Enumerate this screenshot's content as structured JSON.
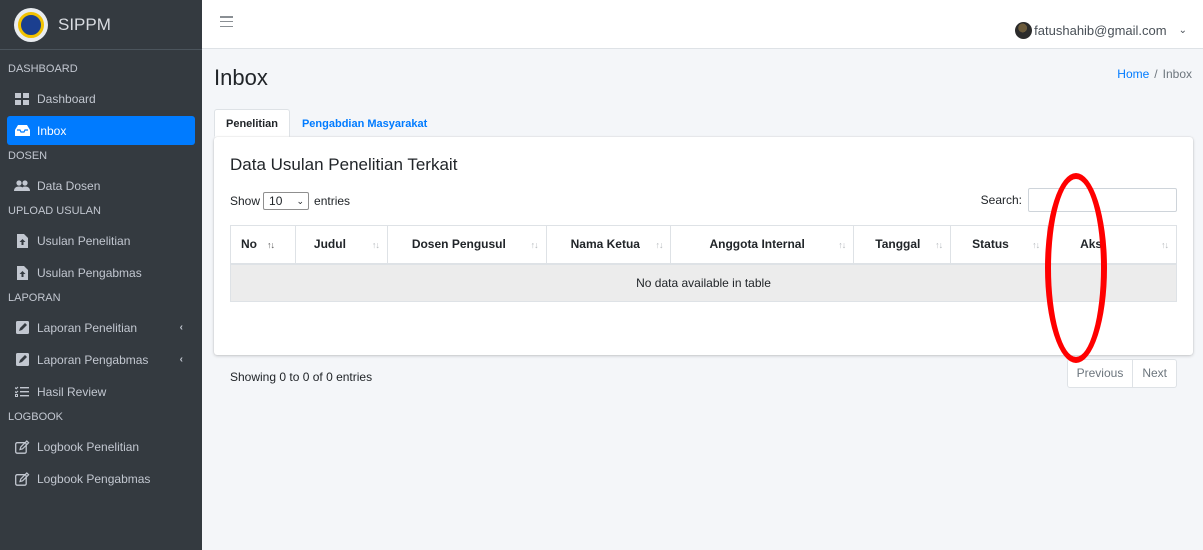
{
  "brand": {
    "name": "SIPPM"
  },
  "sidebar": {
    "sections": [
      {
        "header": "DASHBOARD",
        "items": [
          {
            "label": "Dashboard",
            "icon": "th-large-icon",
            "active": false
          },
          {
            "label": "Inbox",
            "icon": "inbox-icon",
            "active": true
          }
        ]
      },
      {
        "header": "DOSEN",
        "items": [
          {
            "label": "Data Dosen",
            "icon": "users-icon",
            "active": false
          }
        ]
      },
      {
        "header": "UPLOAD USULAN",
        "items": [
          {
            "label": "Usulan Penelitian",
            "icon": "file-upload-icon",
            "active": false
          },
          {
            "label": "Usulan Pengabmas",
            "icon": "file-upload-icon",
            "active": false
          }
        ]
      },
      {
        "header": "LAPORAN",
        "items": [
          {
            "label": "Laporan Penelitian",
            "icon": "edit-icon",
            "active": false,
            "chevron": "‹"
          },
          {
            "label": "Laporan Pengabmas",
            "icon": "edit-icon",
            "active": false,
            "chevron": "‹"
          },
          {
            "label": "Hasil Review",
            "icon": "tasks-icon",
            "active": false
          }
        ]
      },
      {
        "header": "LOGBOOK",
        "items": [
          {
            "label": "Logbook Penelitian",
            "icon": "pen-square-icon",
            "active": false
          },
          {
            "label": "Logbook Pengabmas",
            "icon": "pen-square-icon",
            "active": false
          }
        ]
      }
    ]
  },
  "topbar": {
    "user_email": "fatushahib@gmail.com",
    "caret": "⌄"
  },
  "page": {
    "title": "Inbox"
  },
  "breadcrumb": {
    "home": "Home",
    "separator": "/",
    "current": "Inbox"
  },
  "tabs": [
    {
      "label": "Penelitian",
      "active": true
    },
    {
      "label": "Pengabdian Masyarakat",
      "active": false
    }
  ],
  "card": {
    "title": "Data Usulan Penelitian Terkait"
  },
  "datatable": {
    "show_label": "Show",
    "entries_label": "entries",
    "length_value": "10",
    "search_label": "Search:",
    "search_value": "",
    "columns": [
      "No",
      "Judul",
      "Dosen Pengusul",
      "Nama Ketua",
      "Anggota Internal",
      "Tanggal",
      "Status",
      "Aksi"
    ],
    "empty_text": "No data available in table",
    "info": "Showing 0 to 0 of 0 entries",
    "previous_label": "Previous",
    "next_label": "Next"
  },
  "colors": {
    "accent": "#007bff",
    "sidebar_bg": "#343a40",
    "annotation": "#ff0000"
  }
}
